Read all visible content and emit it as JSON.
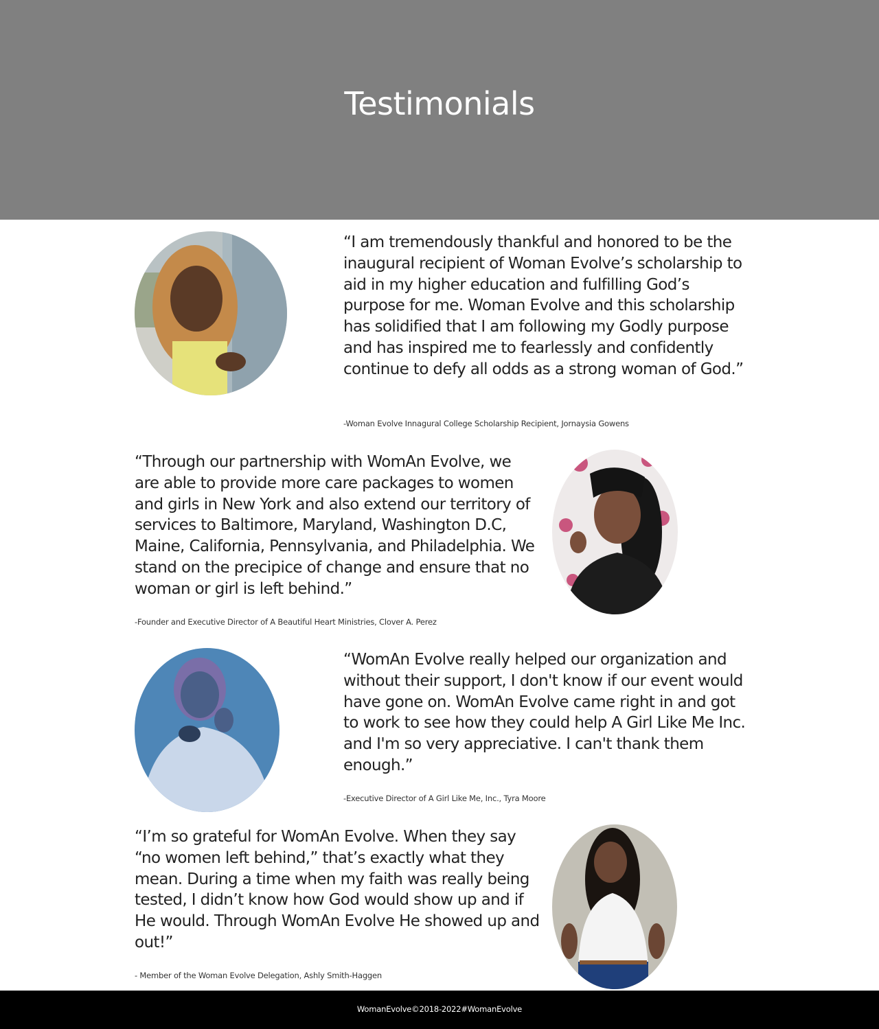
{
  "header": {
    "title": "Testimonials",
    "background": "#808080"
  },
  "testimonials": [
    {
      "quote": "“I am tremendously thankful and honored to be the inaugural recipient of Woman Evolve’s scholarship to aid in my higher education and fulfilling God’s purpose for me. Woman Evolve and this scholarship has solidified that I am following my Godly purpose and has inspired me to fearlessly and confidently continue to defy all odds as a strong woman of God.”",
      "attribution": "-Woman Evolve Innagural College Scholarship Recipient, Jornaysia Gowens",
      "photo_side": "left"
    },
    {
      "quote": "“Through our partnership with WomAn Evolve, we are able to provide more care packages to women and girls in New York and also extend our territory of services to Baltimore, Maryland, Washington D.C, Maine, California, Pennsylvania, and Philadelphia. We stand on the precipice of change and ensure that no woman or girl is left behind.”",
      "attribution": "-Founder and Executive Director of A Beautiful Heart Ministries, Clover A. Perez",
      "photo_side": "right"
    },
    {
      "quote": "“WomAn Evolve really helped our organization and without their support, I don't know if our event would have gone on. WomAn Evolve came right in and got to work to see how they could help A Girl Like Me Inc. and I'm so very appreciative. I can't thank them enough.”",
      "attribution": "-Executive Director of A Girl Like Me, Inc., Tyra Moore",
      "photo_side": "left"
    },
    {
      "quote": "“I’m so grateful for WomAn Evolve. When they say “no women left behind,” that’s exactly what they mean. During a time when my faith was really being tested, I didn’t know how God would show up and if He would. Through WomAn Evolve He showed up and out!”",
      "attribution": "- Member of the Woman Evolve Delegation, Ashly Smith-Haggen",
      "photo_side": "right"
    }
  ],
  "footer": {
    "text": "WomanEvolve©2018-2022#WomanEvolve",
    "background": "#000000"
  }
}
